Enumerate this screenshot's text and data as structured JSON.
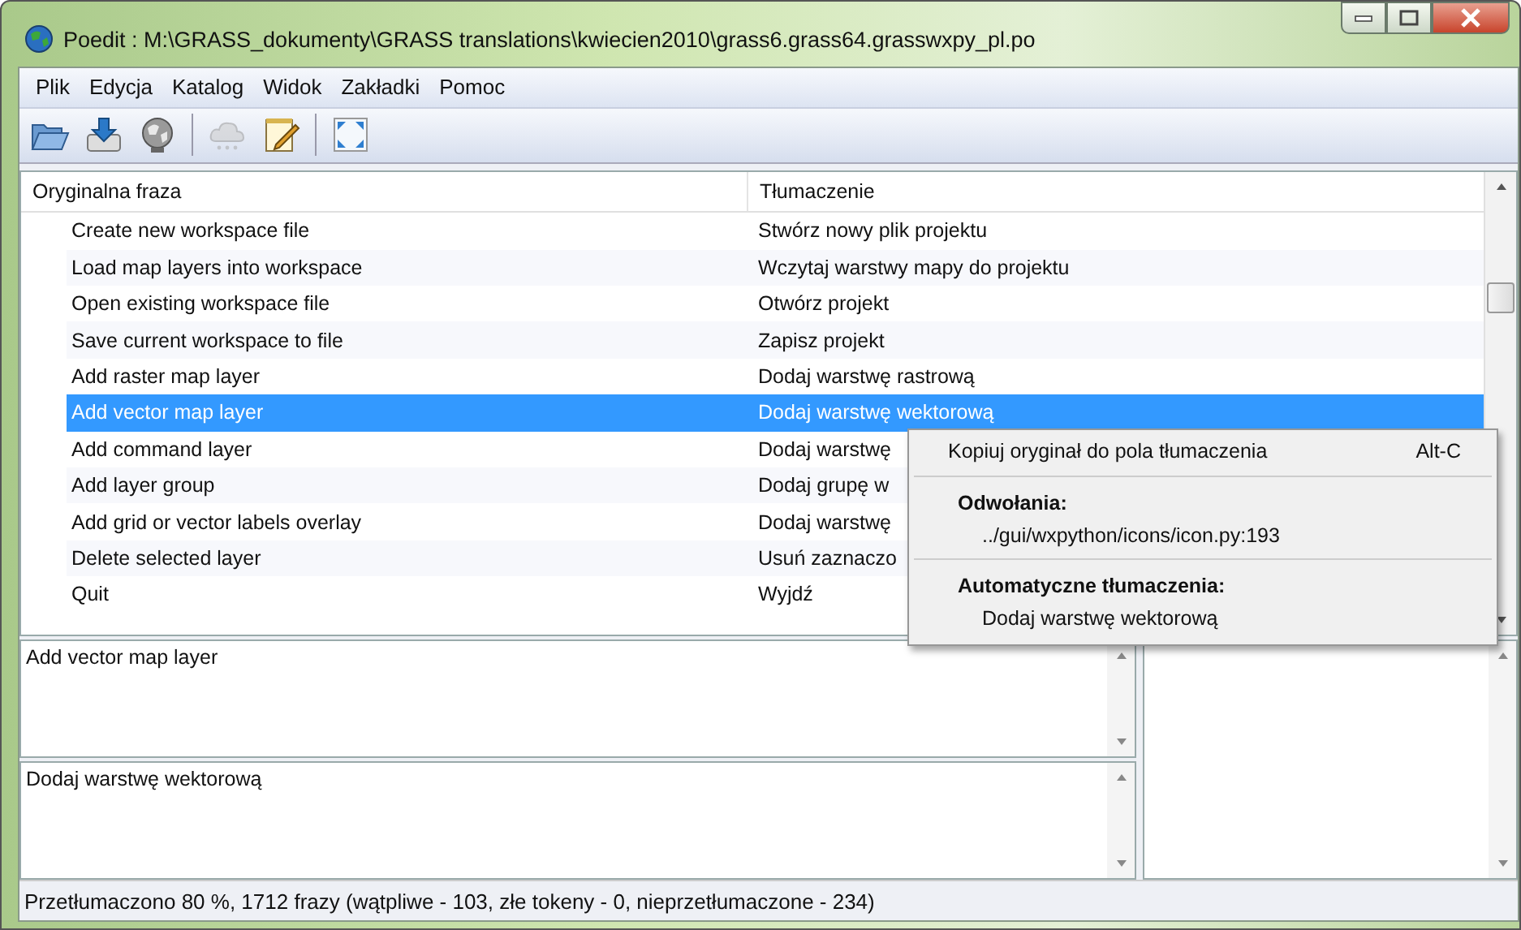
{
  "window": {
    "title": "Poedit : M:\\GRASS_dokumenty\\GRASS translations\\kwiecien2010\\grass6.grass64.grasswxpy_pl.po"
  },
  "menu": [
    "Plik",
    "Edycja",
    "Katalog",
    "Widok",
    "Zakładki",
    "Pomoc"
  ],
  "toolbar": [
    {
      "kind": "open",
      "disabled": false
    },
    {
      "kind": "save",
      "disabled": false
    },
    {
      "kind": "globe",
      "disabled": false
    },
    {
      "kind": "separator"
    },
    {
      "kind": "cloud",
      "disabled": true
    },
    {
      "kind": "notepad",
      "disabled": false
    },
    {
      "kind": "separator"
    },
    {
      "kind": "fullscreen",
      "disabled": false
    }
  ],
  "table": {
    "columns": [
      "Oryginalna fraza",
      "Tłumaczenie"
    ],
    "rows": [
      {
        "original": "Create new workspace file",
        "translation": "Stwórz nowy plik projektu",
        "selected": false
      },
      {
        "original": "Load map layers into workspace",
        "translation": "Wczytaj warstwy mapy do projektu",
        "selected": false
      },
      {
        "original": "Open existing workspace file",
        "translation": "Otwórz projekt",
        "selected": false
      },
      {
        "original": "Save current workspace to file",
        "translation": "Zapisz projekt",
        "selected": false
      },
      {
        "original": "Add raster map layer",
        "translation": "Dodaj warstwę rastrową",
        "selected": false
      },
      {
        "original": "Add vector map layer",
        "translation": "Dodaj warstwę wektorową",
        "selected": true
      },
      {
        "original": "Add command layer",
        "translation": "Dodaj warstwę",
        "selected": false
      },
      {
        "original": "Add layer group",
        "translation": "Dodaj grupę w",
        "selected": false
      },
      {
        "original": "Add grid or vector labels overlay",
        "translation": "Dodaj warstwę",
        "selected": false
      },
      {
        "original": "Delete selected layer",
        "translation": "Usuń zaznaczo",
        "selected": false
      },
      {
        "original": "Quit",
        "translation": "Wyjdź",
        "selected": false
      }
    ]
  },
  "context_menu": {
    "copy_item": {
      "label": "Kopiuj oryginał do pola tłumaczenia",
      "shortcut": "Alt-C"
    },
    "references_heading": "Odwołania:",
    "reference": "../gui/wxpython/icons/icon.py:193",
    "auto_heading": "Automatyczne tłumaczenia:",
    "auto_translation": "Dodaj warstwę wektorową"
  },
  "original_text": "Add vector map layer",
  "translation_text": "Dodaj warstwę wektorową",
  "status_bar": "Przetłumaczono 80 %, 1712 frazy (wątpliwe - 103, złe tokeny - 0, nieprzetłumaczone - 234)"
}
